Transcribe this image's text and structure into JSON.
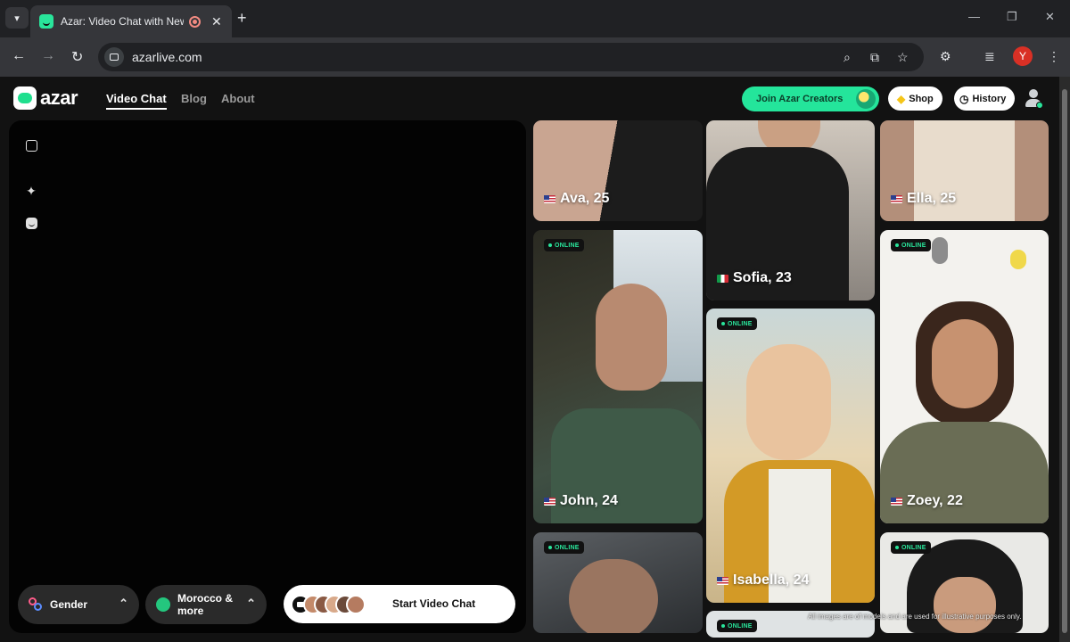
{
  "browser": {
    "tab_title": "Azar: Video Chat with New Pe",
    "url": "azarlive.com",
    "profile_initial": "Y"
  },
  "site": {
    "logo_text": "azar",
    "nav": [
      {
        "label": "Video Chat",
        "active": true
      },
      {
        "label": "Blog",
        "active": false
      },
      {
        "label": "About",
        "active": false
      }
    ],
    "join_creators_label": "Join Azar Creators",
    "shop_label": "Shop",
    "history_label": "History"
  },
  "controls": {
    "gender_label": "Gender",
    "region_label": "Morocco & more",
    "start_label": "Start Video Chat"
  },
  "profiles": [
    {
      "name": "Ava, 25",
      "flag": "us",
      "online": false
    },
    {
      "name": "Sofia, 23",
      "flag": "it",
      "online": false
    },
    {
      "name": "Ella, 25",
      "flag": "us",
      "online": false
    },
    {
      "name": "John, 24",
      "flag": "us",
      "online": true
    },
    {
      "name": "Isabella, 24",
      "flag": "us",
      "online": true
    },
    {
      "name": "Zoey, 22",
      "flag": "us",
      "online": true
    },
    {
      "name": "",
      "flag": "",
      "online": true
    },
    {
      "name": "",
      "flag": "",
      "online": true
    },
    {
      "name": "",
      "flag": "",
      "online": true
    }
  ],
  "online_label": "ONLINE",
  "disclaimer": "All images are of models and are used for illustrative purposes only.",
  "colors": {
    "brand_green": "#24e59b",
    "background": "#121212",
    "panel": "#030303"
  }
}
